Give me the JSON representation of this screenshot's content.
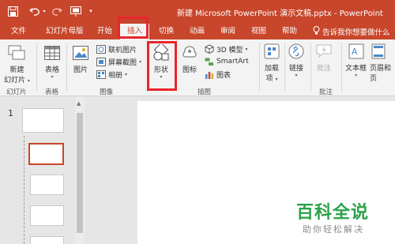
{
  "window": {
    "title": "新建 Microsoft PowerPoint 演示文稿.pptx  -  PowerPoint"
  },
  "colors": {
    "accent": "#c8462b",
    "highlight": "#e8262b",
    "watermark": "#2aa34a"
  },
  "tabs": [
    "文件",
    "幻灯片母版",
    "开始",
    "插入",
    "切换",
    "动画",
    "审阅",
    "视图",
    "帮助"
  ],
  "active_tab": "插入",
  "tell_me": "告诉我你想要做什么",
  "ribbon": {
    "slides": {
      "new_slide": "新建",
      "new_slide2": "幻灯片",
      "group": "幻灯片"
    },
    "tables": {
      "table": "表格",
      "group": "表格"
    },
    "images": {
      "picture": "图片",
      "online": "联机图片",
      "screenshot": "屏幕截图",
      "album": "相册",
      "group": "图像"
    },
    "illustrations": {
      "shapes": "形状",
      "icons": "图标",
      "model3d": "3D 模型",
      "smartart": "SmartArt",
      "chart": "图表",
      "group": "插图"
    },
    "addins": {
      "addins": "加载",
      "addins2": "项"
    },
    "links": {
      "link": "链接"
    },
    "comments": {
      "comment": "批注",
      "group": "批注"
    },
    "text": {
      "textbox": "文本框",
      "header": "页眉和页"
    }
  },
  "slide_panel": {
    "slide_number": "1"
  },
  "watermark": {
    "title": "百科全说",
    "subtitle": "助你轻松解决"
  }
}
